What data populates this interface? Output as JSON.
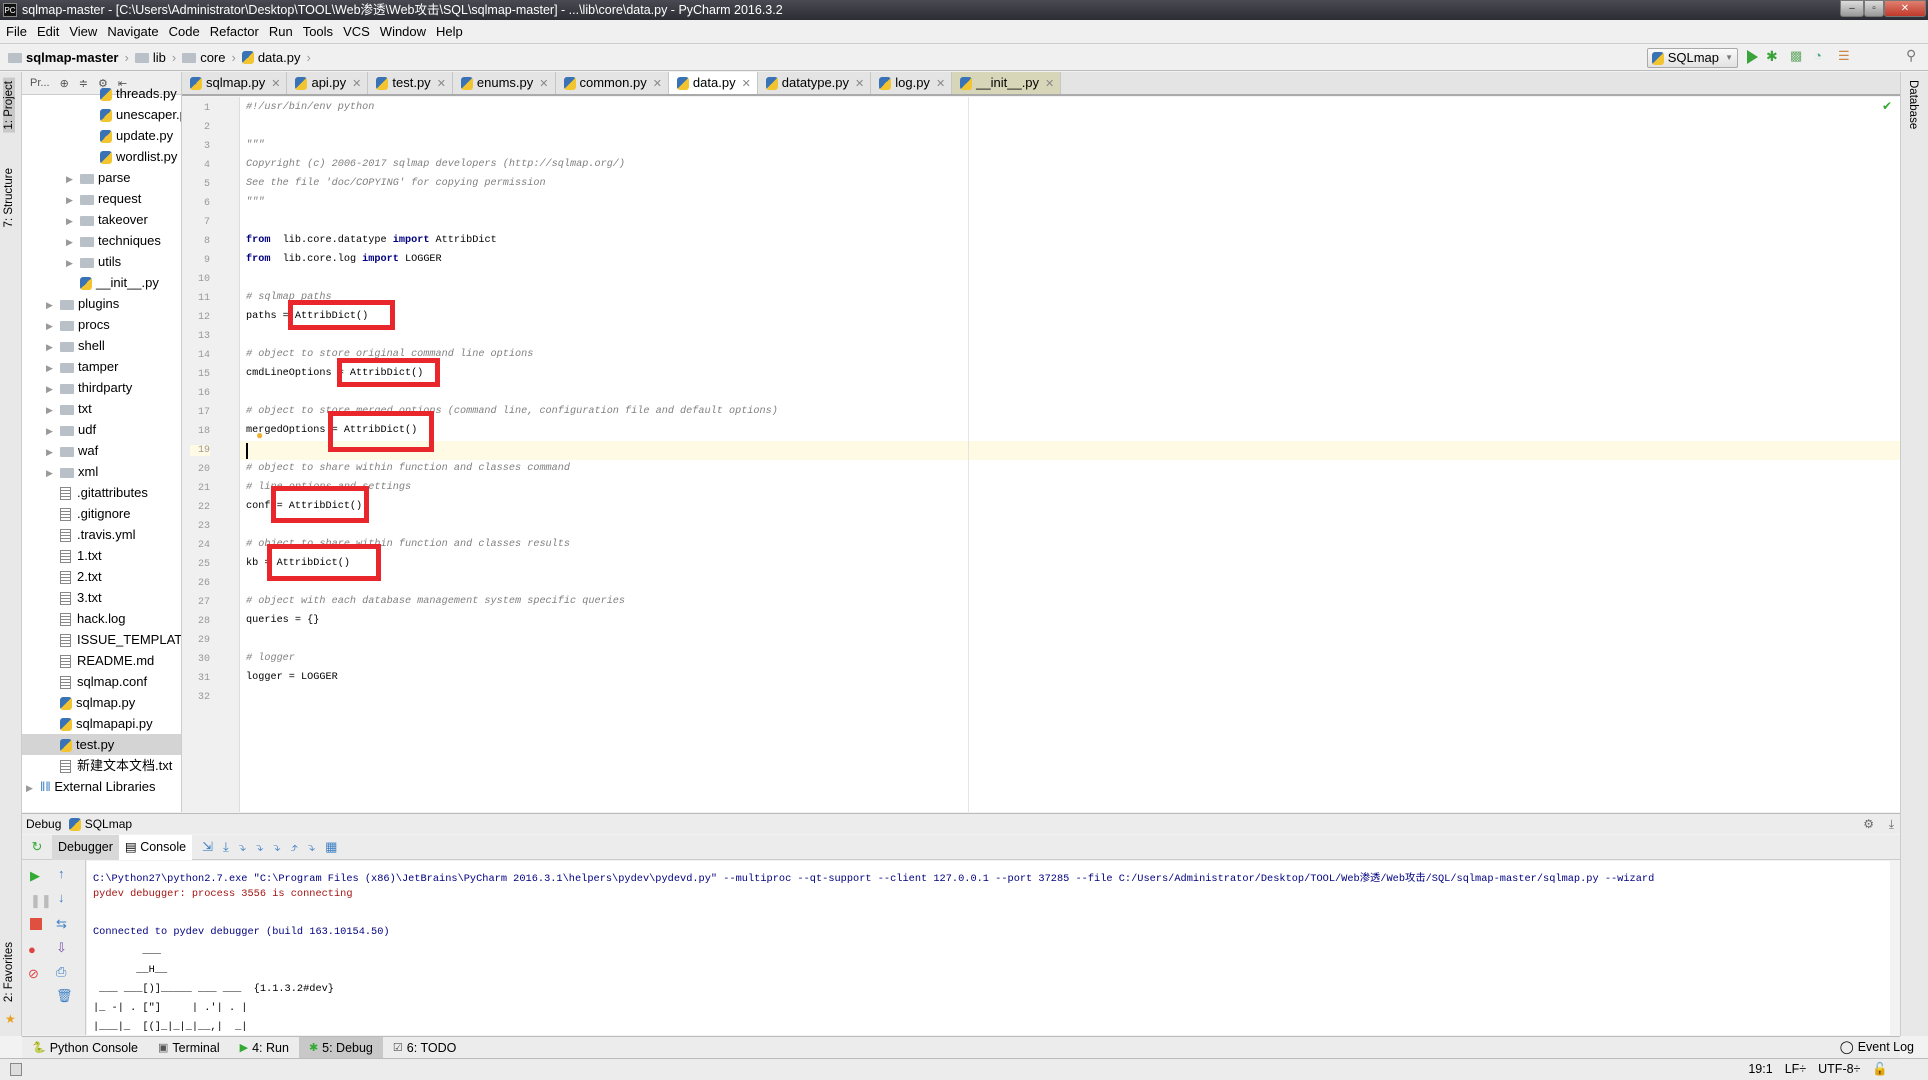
{
  "window": {
    "title": "sqlmap-master - [C:\\Users\\Administrator\\Desktop\\TOOL\\Web渗透\\Web攻击\\SQL\\sqlmap-master] - ...\\lib\\core\\data.py - PyCharm 2016.3.2",
    "logo": "PC"
  },
  "menu": [
    "File",
    "Edit",
    "View",
    "Navigate",
    "Code",
    "Refactor",
    "Run",
    "Tools",
    "VCS",
    "Window",
    "Help"
  ],
  "breadcrumb": [
    "sqlmap-master",
    "lib",
    "core",
    "data.py"
  ],
  "run_config": "SQLmap",
  "left_strip": {
    "project": "1: Project",
    "structure": "7: Structure",
    "favorites": "2: Favorites"
  },
  "right_strip": {
    "database": "Database"
  },
  "project_toolbar": {
    "view_label": "Pr..."
  },
  "tree": [
    {
      "label": "threads.py",
      "indent": 3,
      "type": "py"
    },
    {
      "label": "unescaper.py",
      "indent": 3,
      "type": "py"
    },
    {
      "label": "update.py",
      "indent": 3,
      "type": "py"
    },
    {
      "label": "wordlist.py",
      "indent": 3,
      "type": "py"
    },
    {
      "label": "parse",
      "indent": 2,
      "type": "folder"
    },
    {
      "label": "request",
      "indent": 2,
      "type": "folder"
    },
    {
      "label": "takeover",
      "indent": 2,
      "type": "folder"
    },
    {
      "label": "techniques",
      "indent": 2,
      "type": "folder"
    },
    {
      "label": "utils",
      "indent": 2,
      "type": "folder"
    },
    {
      "label": "__init__.py",
      "indent": 2,
      "type": "py"
    },
    {
      "label": "plugins",
      "indent": 1,
      "type": "folder"
    },
    {
      "label": "procs",
      "indent": 1,
      "type": "folder"
    },
    {
      "label": "shell",
      "indent": 1,
      "type": "folder"
    },
    {
      "label": "tamper",
      "indent": 1,
      "type": "folder"
    },
    {
      "label": "thirdparty",
      "indent": 1,
      "type": "folder"
    },
    {
      "label": "txt",
      "indent": 1,
      "type": "folder"
    },
    {
      "label": "udf",
      "indent": 1,
      "type": "folder"
    },
    {
      "label": "waf",
      "indent": 1,
      "type": "folder"
    },
    {
      "label": "xml",
      "indent": 1,
      "type": "folder"
    },
    {
      "label": ".gitattributes",
      "indent": 1,
      "type": "file"
    },
    {
      "label": ".gitignore",
      "indent": 1,
      "type": "file"
    },
    {
      "label": ".travis.yml",
      "indent": 1,
      "type": "file"
    },
    {
      "label": "1.txt",
      "indent": 1,
      "type": "file"
    },
    {
      "label": "2.txt",
      "indent": 1,
      "type": "file"
    },
    {
      "label": "3.txt",
      "indent": 1,
      "type": "file"
    },
    {
      "label": "hack.log",
      "indent": 1,
      "type": "file"
    },
    {
      "label": "ISSUE_TEMPLATE.md",
      "indent": 1,
      "type": "file"
    },
    {
      "label": "README.md",
      "indent": 1,
      "type": "file"
    },
    {
      "label": "sqlmap.conf",
      "indent": 1,
      "type": "file"
    },
    {
      "label": "sqlmap.py",
      "indent": 1,
      "type": "py"
    },
    {
      "label": "sqlmapapi.py",
      "indent": 1,
      "type": "py"
    },
    {
      "label": "test.py",
      "indent": 1,
      "type": "py",
      "selected": true
    },
    {
      "label": "新建文本文档.txt",
      "indent": 1,
      "type": "file"
    },
    {
      "label": "External Libraries",
      "indent": 0,
      "type": "lib"
    }
  ],
  "tabs": [
    {
      "label": "sqlmap.py"
    },
    {
      "label": "api.py"
    },
    {
      "label": "test.py"
    },
    {
      "label": "enums.py"
    },
    {
      "label": "common.py"
    },
    {
      "label": "data.py",
      "active": true
    },
    {
      "label": "datatype.py"
    },
    {
      "label": "log.py"
    },
    {
      "label": "__init__.py",
      "highlight": true
    }
  ],
  "code": [
    [
      [
        "cm",
        "#!/usr/bin/env python"
      ]
    ],
    [],
    [
      [
        "cm",
        "\"\"\""
      ]
    ],
    [
      [
        "cm",
        "Copyright (c) 2006-2017 sqlmap developers (http://sqlmap.org/)"
      ]
    ],
    [
      [
        "cm",
        "See the file 'doc/COPYING' for copying permission"
      ]
    ],
    [
      [
        "cm",
        "\"\"\""
      ]
    ],
    [],
    [
      [
        "kw",
        "from"
      ],
      [
        "",
        "  lib.core.datatype "
      ],
      [
        "kw",
        "import"
      ],
      [
        "",
        " AttribDict"
      ]
    ],
    [
      [
        "kw",
        "from"
      ],
      [
        "",
        "  lib.core.log "
      ],
      [
        "kw",
        "import"
      ],
      [
        "",
        " LOGGER"
      ]
    ],
    [],
    [
      [
        "cm",
        "# sqlmap paths"
      ]
    ],
    [
      [
        "",
        "paths = AttribDict()"
      ]
    ],
    [],
    [
      [
        "cm",
        "# object to store original command line options"
      ]
    ],
    [
      [
        "",
        "cmdLineOptions = AttribDict()"
      ]
    ],
    [],
    [
      [
        "cm",
        "# object to store merged options (command line, configuration file and default options)"
      ]
    ],
    [
      [
        "",
        "mergedOptions = AttribDict()"
      ]
    ],
    [],
    [
      [
        "cm",
        "# object to share within function and classes command"
      ]
    ],
    [
      [
        "cm",
        "# line options and settings"
      ]
    ],
    [
      [
        "",
        "conf = AttribDict()"
      ]
    ],
    [],
    [
      [
        "cm",
        "# object to share within function and classes results"
      ]
    ],
    [
      [
        "",
        "kb = AttribDict()"
      ]
    ],
    [],
    [
      [
        "cm",
        "# object with each database management system specific queries"
      ]
    ],
    [
      [
        "",
        "queries = {}"
      ]
    ],
    [],
    [
      [
        "cm",
        "# logger"
      ]
    ],
    [
      [
        "",
        "logger = LOGGER"
      ]
    ],
    []
  ],
  "debug": {
    "label": "Debug",
    "config": "SQLmap",
    "tabs": [
      "Debugger",
      "Console"
    ]
  },
  "console": [
    {
      "text": "C:\\Python27\\python2.7.exe \"C:\\Program Files (x86)\\JetBrains\\PyCharm 2016.3.1\\helpers\\pydev\\pydevd.py\" --multiproc --qt-support --client 127.0.0.1 --port 37285 --file C:/Users/Administrator/Desktop/TOOL/Web渗透/Web攻击/SQL/sqlmap-master/sqlmap.py --wizard",
      "color": "#000080"
    },
    {
      "text": "pydev debugger: process 3556 is connecting",
      "color": "#a31515"
    },
    {
      "text": "",
      "color": "#000"
    },
    {
      "text": "Connected to pydev debugger (build 163.10154.50)",
      "color": "#000080"
    },
    {
      "text": "        ___",
      "color": "#000"
    },
    {
      "text": "       __H__",
      "color": "#000"
    },
    {
      "text": " ___ ___[)]_____ ___ ___  {1.1.3.2#dev}",
      "color": "#000"
    },
    {
      "text": "|_ -| . [\"]     | .'| . |",
      "color": "#000"
    },
    {
      "text": "|___|_  [(]_|_|_|__,|  _|",
      "color": "#000"
    }
  ],
  "bottom_tools": [
    {
      "label": "Python Console"
    },
    {
      "label": "Terminal"
    },
    {
      "label": "4: Run"
    },
    {
      "label": "5: Debug",
      "active": true
    },
    {
      "label": "6: TODO"
    }
  ],
  "event_log": "Event Log",
  "status": {
    "position": "19:1",
    "line_sep": "LF÷",
    "encoding": "UTF-8÷"
  },
  "colors": {
    "highlight_box": "#e8262b",
    "keyword": "#000080",
    "comment": "#808080",
    "current_line": "#fffae3"
  }
}
